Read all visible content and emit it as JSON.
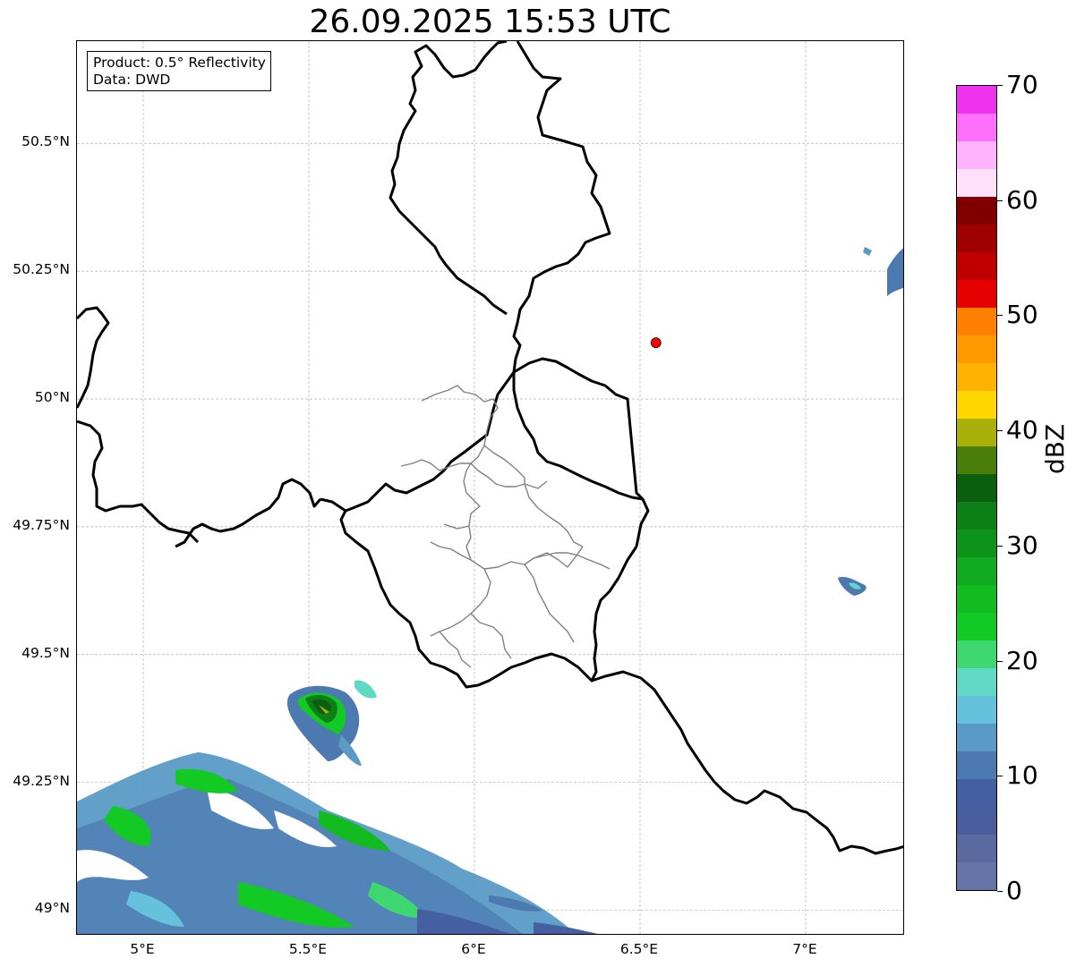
{
  "title": "26.09.2025 15:53 UTC",
  "info": {
    "product": "Product: 0.5° Reflectivity",
    "source": "Data: DWD"
  },
  "map": {
    "lon_range": [
      4.8,
      7.3
    ],
    "lat_range": [
      48.95,
      50.7
    ],
    "lat_ticks": [
      {
        "value": 50.5,
        "label": "50.5°N"
      },
      {
        "value": 50.25,
        "label": "50.25°N"
      },
      {
        "value": 50.0,
        "label": "50°N"
      },
      {
        "value": 49.75,
        "label": "49.75°N"
      },
      {
        "value": 49.5,
        "label": "49.5°N"
      },
      {
        "value": 49.25,
        "label": "49.25°N"
      },
      {
        "value": 49.0,
        "label": "49°N"
      }
    ],
    "lon_ticks": [
      {
        "value": 5.0,
        "label": "5°E"
      },
      {
        "value": 5.5,
        "label": "5.5°E"
      },
      {
        "value": 6.0,
        "label": "6°E"
      },
      {
        "value": 6.5,
        "label": "6.5°E"
      },
      {
        "value": 7.0,
        "label": "7°E"
      }
    ],
    "radar_site": {
      "lon": 6.548,
      "lat": 50.11,
      "color": "#ff0000"
    },
    "border_color": "#000000",
    "district_color": "#808080",
    "gridline_color": "#b0b0b0"
  },
  "colorbar": {
    "unit": "dBZ",
    "min": 0,
    "max": 70,
    "ticks": [
      0,
      10,
      20,
      30,
      40,
      50,
      60,
      70
    ],
    "tick_labels": [
      "0",
      "10",
      "20",
      "30",
      "40",
      "50",
      "60",
      "70"
    ],
    "colors": [
      "#6474a8",
      "#586aa0",
      "#4a5e9e",
      "#4460a2",
      "#4c79b0",
      "#5a9ac6",
      "#66c2dc",
      "#60d8c6",
      "#3fd770",
      "#13c923",
      "#12bb20",
      "#11a91d",
      "#0e931a",
      "#0c7f17",
      "#0a5f0e",
      "#4a7c0a",
      "#aab00a",
      "#ffd700",
      "#ffb300",
      "#ff9900",
      "#ff7f00",
      "#e60000",
      "#c00000",
      "#a00000",
      "#800000",
      "#ffe0fa",
      "#ffb3fa",
      "#ff70fa",
      "#ee33ee"
    ]
  }
}
